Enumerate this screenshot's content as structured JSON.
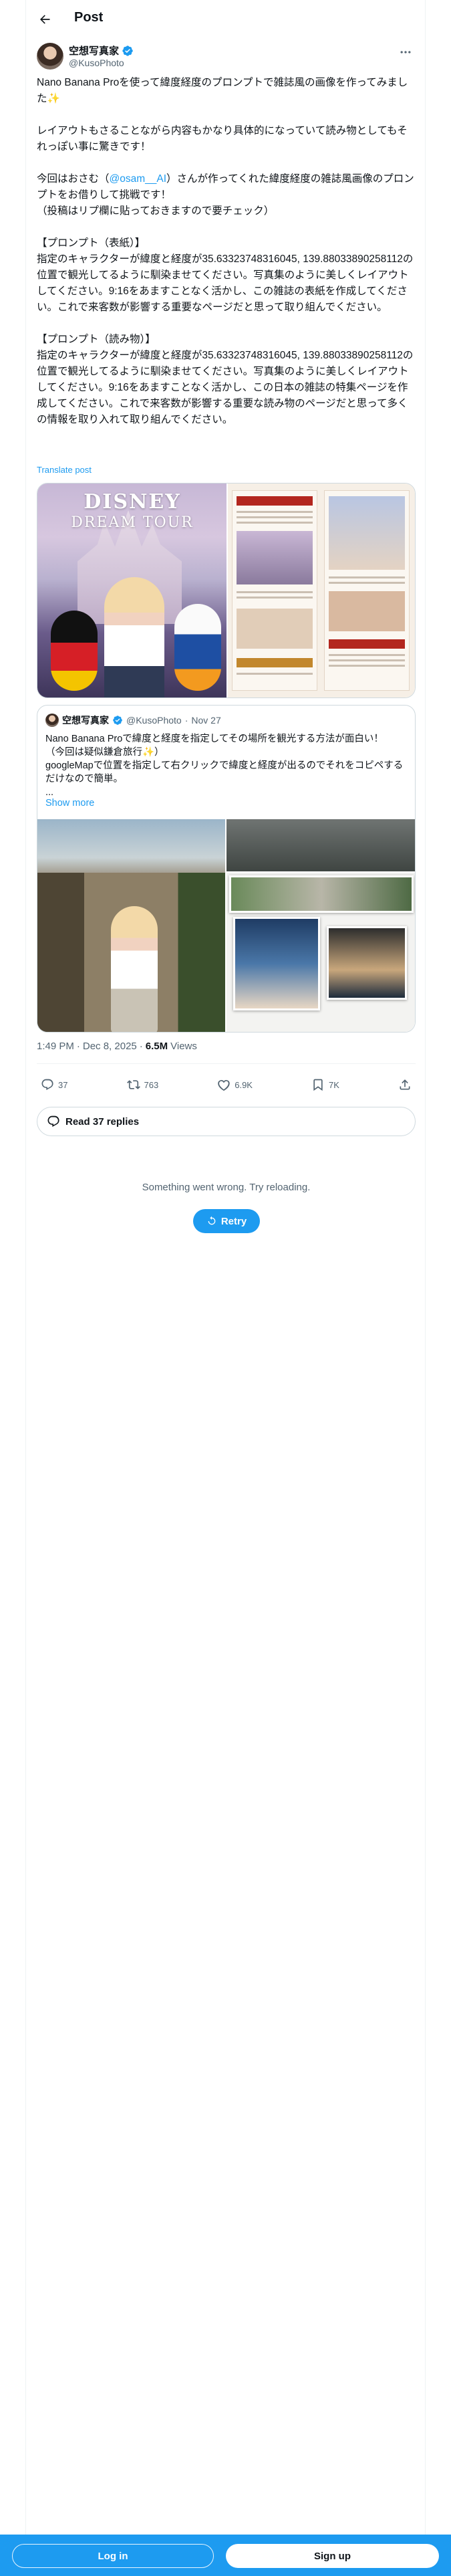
{
  "header": {
    "title": "Post"
  },
  "author": {
    "display_name": "空想写真家",
    "handle": "@KusoPhoto",
    "verified_icon": "verified-badge-icon",
    "more_icon": "more-horizontal-icon"
  },
  "tweet": {
    "text_intro": "Nano Banana Proを使って緯度経度のプロンプトで雑誌風の画像を作ってみました✨\n\nレイアウトもさることながら内容もかなり具体的になっていて読み物としてもそれっぽい事に驚きです！\n\n今回はおさむ（",
    "mention": "@osam__AI",
    "text_body": "）さんが作ってくれた緯度経度の雑誌風画像のプロンプトをお借りして挑戦です！\n（投稿はリプ欄に貼っておきますので要チェック）\n\n【プロンプト（表紙）】\n指定のキャラクターが緯度と経度が35.63323748316045, 139.88033890258112の位置で観光してるように馴染ませてください。写真集のように美しくレイアウトしてください。9:16をあますことなく活かし、この雑誌の表紙を作成してください。これで来客数が影響する重要なページだと思って取り組んでください。\n\n【プロンプト（読み物）】\n指定のキャラクターが緯度と経度が35.63323748316045, 139.88033890258112の位置で観光してるように馴染ませてください。写真集のように美しくレイアウトしてください。9:16をあますことなく活かし、この日本の雑誌の特集ページを作成してください。これで来客数が影響する重要な読み物のページだと思って多くの情報を取り入れて取り組んでください。",
    "translate_label": "Translate post"
  },
  "media": {
    "cover_title": "DISNEY",
    "cover_subtitle": "DREAM TOUR"
  },
  "quote": {
    "display_name": "空想写真家",
    "handle": "@KusoPhoto",
    "separator": "·",
    "date": "Nov 27",
    "text": "Nano Banana Proで緯度と経度を指定してその場所を観光する方法が面白い！\n（今回は疑似鎌倉旅行✨）\ngoogleMapで位置を指定して右クリックで緯度と経度が出るのでそれをコピペするだけなので簡単。\n...",
    "show_more": "Show more"
  },
  "meta": {
    "time": "1:49 PM",
    "separator": "·",
    "date": "Dec 8, 2025",
    "views_count": "6.5M",
    "views_label": "Views"
  },
  "actions": {
    "reply_count": "37",
    "repost_count": "763",
    "like_count": "6.9K",
    "bookmark_count": "7K"
  },
  "replies": {
    "label": "Read 37 replies"
  },
  "error": {
    "message": "Something went wrong. Try reloading.",
    "retry_label": "Retry"
  },
  "bottom_bar": {
    "login_label": "Log in",
    "signup_label": "Sign up"
  },
  "colors": {
    "accent": "#1d9bf0",
    "text": "#0f1419",
    "secondary": "#536471",
    "border": "#cfd9de"
  }
}
